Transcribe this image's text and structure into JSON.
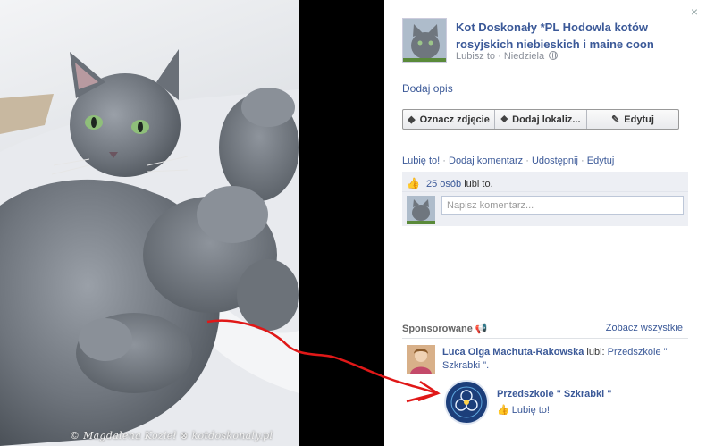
{
  "photo": {
    "watermark": "© Magdalena Kozieł ⊗ kotdoskonaly.pl"
  },
  "panel": {
    "close_icon": "×",
    "page_name": "Kot Doskonały *PL Hodowla kotów rosyjskich niebieskich i maine coon",
    "meta": {
      "likes_label": "Lubisz to",
      "separator": "·",
      "date": "Niedziela",
      "privacy_icon": "globe-icon"
    },
    "add_description": "Dodaj opis",
    "toolbar": {
      "tag": {
        "icon": "tag-icon",
        "label": "Oznacz zdjęcie"
      },
      "location": {
        "icon": "location-pin-icon",
        "label": "Dodaj lokaliz..."
      },
      "edit": {
        "icon": "pencil-icon",
        "label": "Edytuj"
      }
    },
    "actions": {
      "like": "Lubię to!",
      "comment": "Dodaj komentarz",
      "share": "Udostępnij",
      "edit": "Edytuj",
      "separator": "·"
    },
    "likes": {
      "count": "25 osób",
      "suffix": "lubi to."
    },
    "comment": {
      "placeholder": "Napisz komentarz..."
    },
    "sponsored": {
      "title": "Sponsorowane",
      "see_all": "Zobacz wszystkie",
      "person": "Luca Olga Machuta-Rakowska",
      "liked_verb": "lubi:",
      "liked_page": "Przedszkole \" Szkrabki \".",
      "ad_page_name": "Przedszkole \" Szkrabki \"",
      "ad_like": "Lubię to!"
    }
  },
  "colors": {
    "link": "#3b5998",
    "muted": "#8a8f99",
    "likebox_bg": "#edeff4",
    "stage_bg": "#000000",
    "annotation_arrow": "#e01818"
  }
}
